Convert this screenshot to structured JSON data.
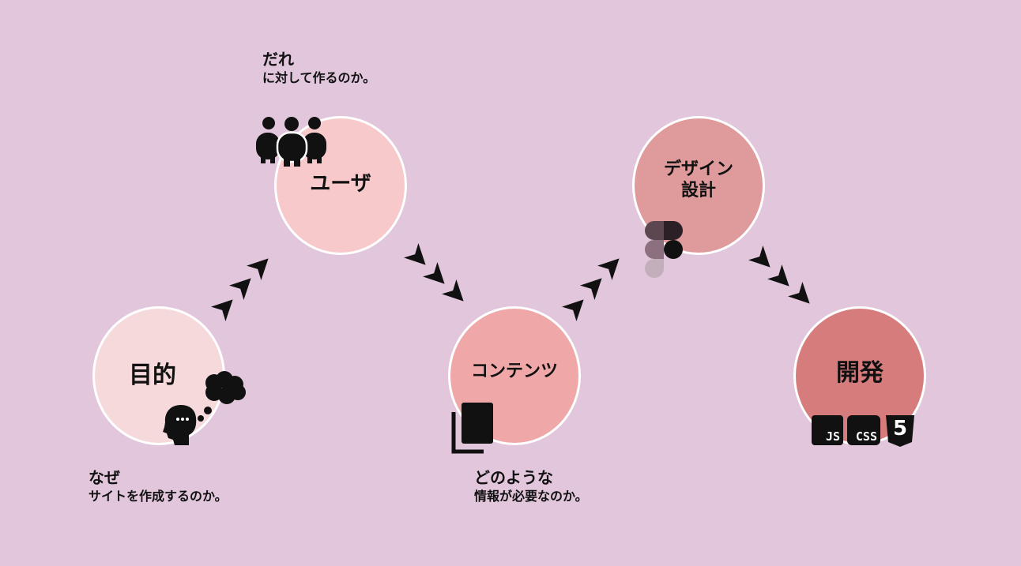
{
  "nodes": [
    {
      "label": "目的",
      "color": "#f6dadb"
    },
    {
      "label": "ユーザ",
      "color": "#f7c9ca"
    },
    {
      "label": "コンテンツ",
      "color": "#efa7a8"
    },
    {
      "label": "デザイン\n設計",
      "color": "#df9a9b"
    },
    {
      "label": "開発",
      "color": "#d67c7d"
    }
  ],
  "captions": {
    "purpose": {
      "line1": "なぜ",
      "line2": "サイトを作成するのか。"
    },
    "user": {
      "line1": "だれ",
      "line2": "に対して作るのか。"
    },
    "content": {
      "line1": "どのような",
      "line2": "情報が必要なのか。"
    }
  },
  "tech_badges": {
    "js": "JS",
    "css": "CSS",
    "html": "5"
  },
  "icons": [
    "thinking-person-icon",
    "user-group-icon",
    "copy-documents-icon",
    "figma-logo-icon",
    "js-badge-icon",
    "css-badge-icon",
    "html5-icon",
    "flow-arrow-icon"
  ],
  "colors": {
    "background": "#e2c6dc",
    "border": "#ffffff",
    "ink": "#111111"
  }
}
